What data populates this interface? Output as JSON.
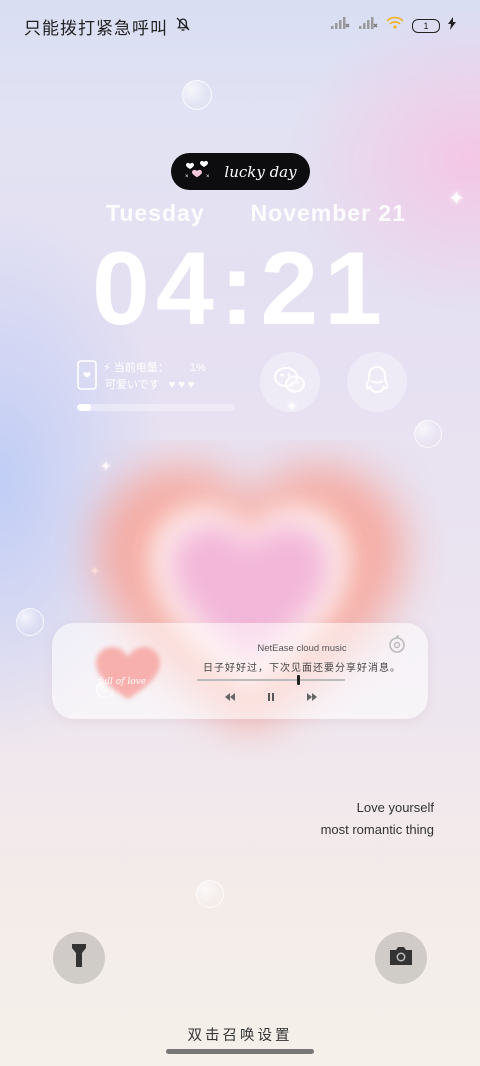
{
  "status_bar": {
    "carrier_text": "只能拨打紧急呼叫",
    "silent_icon": "bell-off-icon",
    "battery_level": "1",
    "charging_icon": "bolt-icon"
  },
  "lockscreen": {
    "badge_text": "lucky day",
    "day": "Tuesday",
    "date": "November 21",
    "time": "04:21"
  },
  "battery_widget": {
    "label": "当前电量：",
    "percent_text": "1%",
    "subtitle": "可爱いです",
    "hearts": "♥ ♥ ♥",
    "level": 0.01
  },
  "shortcuts": {
    "wechat_icon": "wechat-icon",
    "qq_icon": "qq-penguin-icon"
  },
  "music": {
    "album_caption": "full of love",
    "app_name": "NetEase cloud music",
    "lyric": "日子好好过，下次见面还要分享好消息。",
    "progress": 0.68
  },
  "quote": {
    "line1": "Love yourself",
    "line2": "most romantic thing"
  },
  "bottom": {
    "hint": "双击召唤设置"
  },
  "colors": {
    "pill_bg": "#0d0d10",
    "heart_pink": "#f3b7d9",
    "heart_glow": "#f7a7a0"
  }
}
